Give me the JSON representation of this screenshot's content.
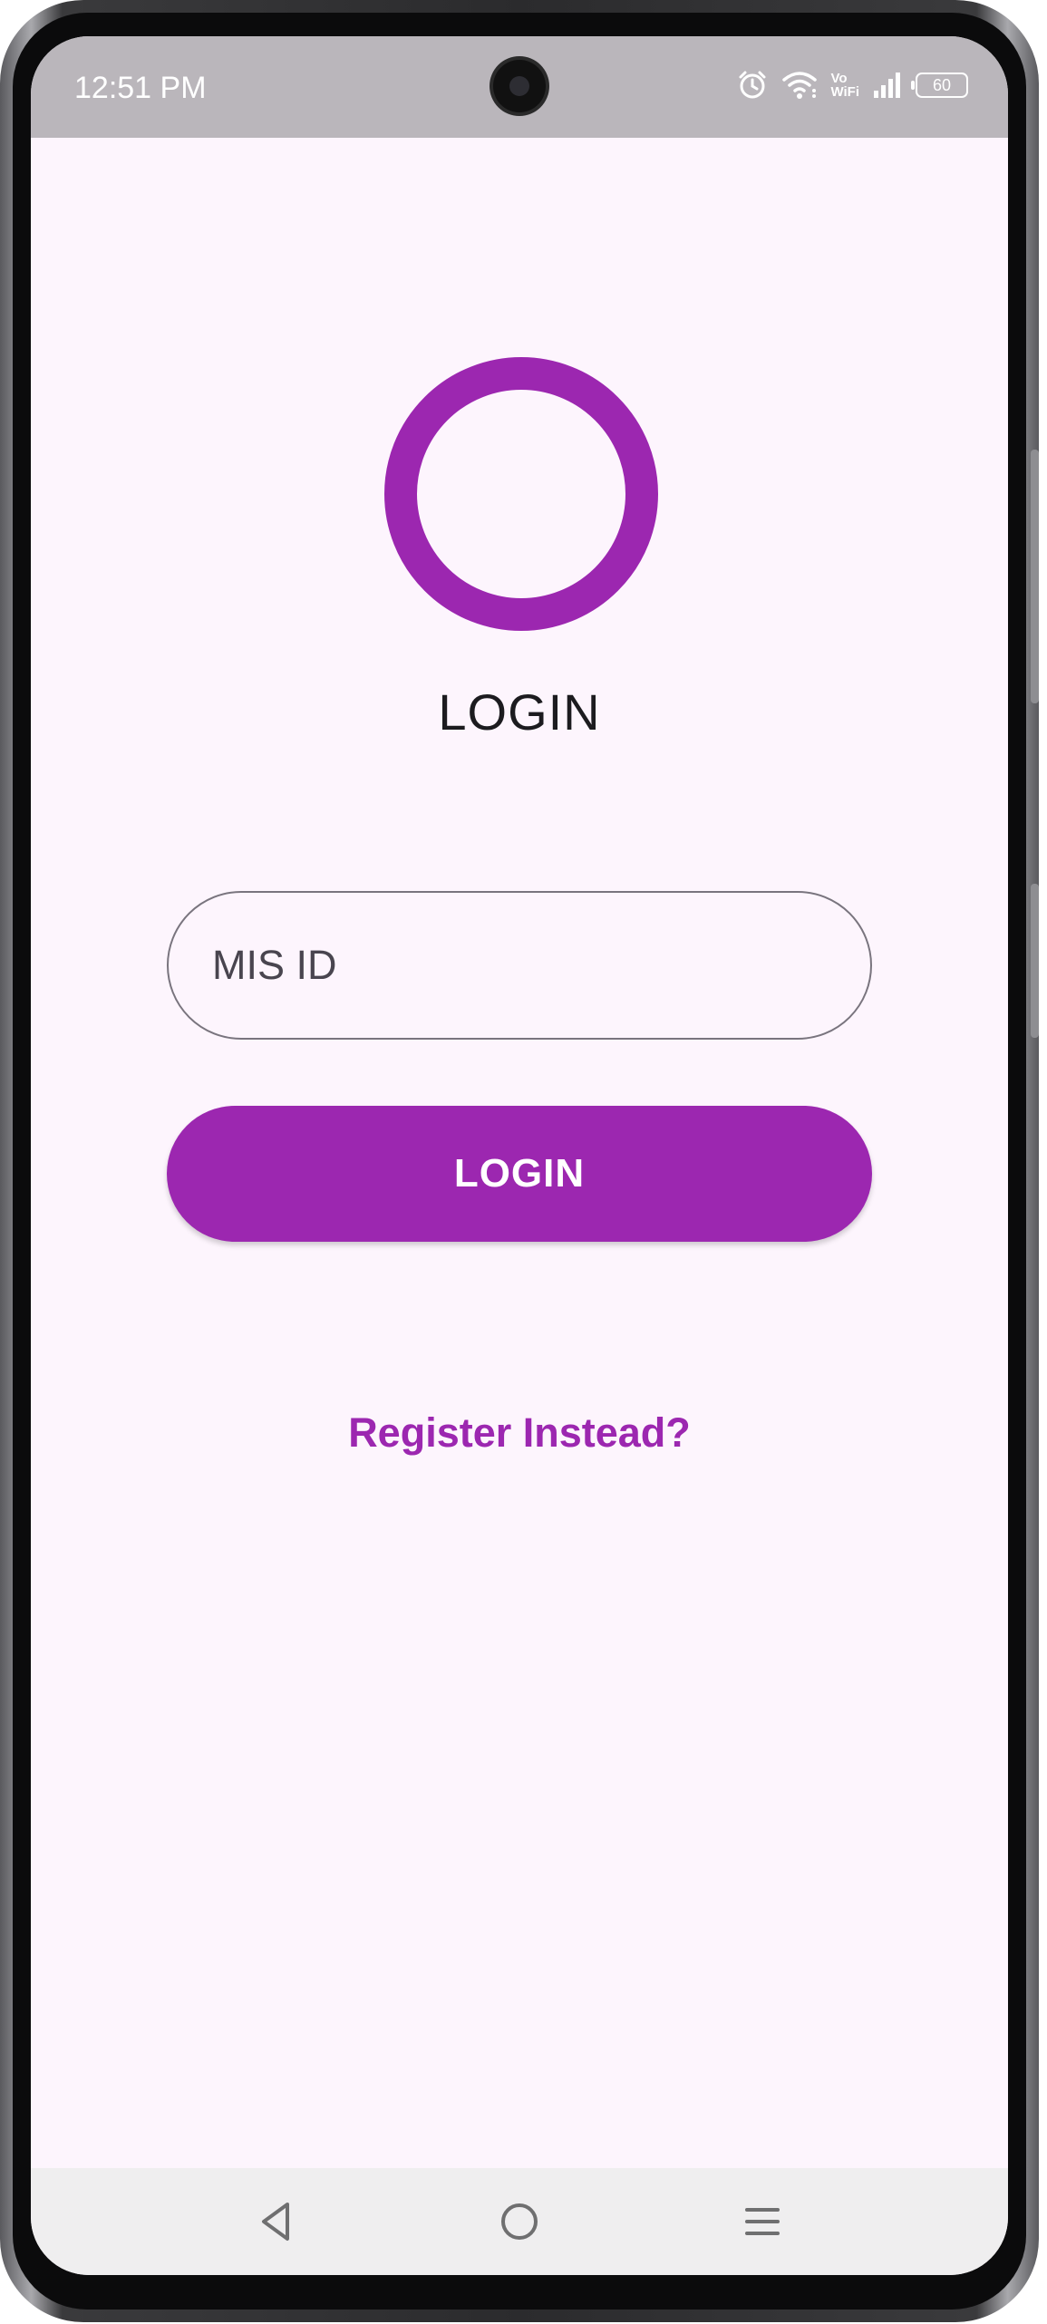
{
  "status_bar": {
    "time": "12:51 PM",
    "icons": [
      "alarm-icon",
      "wifi-icon",
      "vowifi-icon",
      "signal-icon",
      "battery-icon"
    ],
    "vowifi_top": "Vo",
    "vowifi_bottom": "WiFi",
    "battery_level": "60"
  },
  "login": {
    "logo": "ring-logo",
    "title": "LOGIN",
    "mis_id_placeholder": "MIS ID",
    "mis_id_value": "",
    "login_button_label": "LOGIN",
    "register_link": "Register Instead?"
  },
  "nav_bar": {
    "items": [
      "back-icon",
      "home-icon",
      "recents-icon"
    ]
  },
  "colors": {
    "accent": "#9c27b0",
    "background": "#fdf5fd",
    "status_bar": "#bab6bb",
    "nav_bar": "#efeeef"
  }
}
